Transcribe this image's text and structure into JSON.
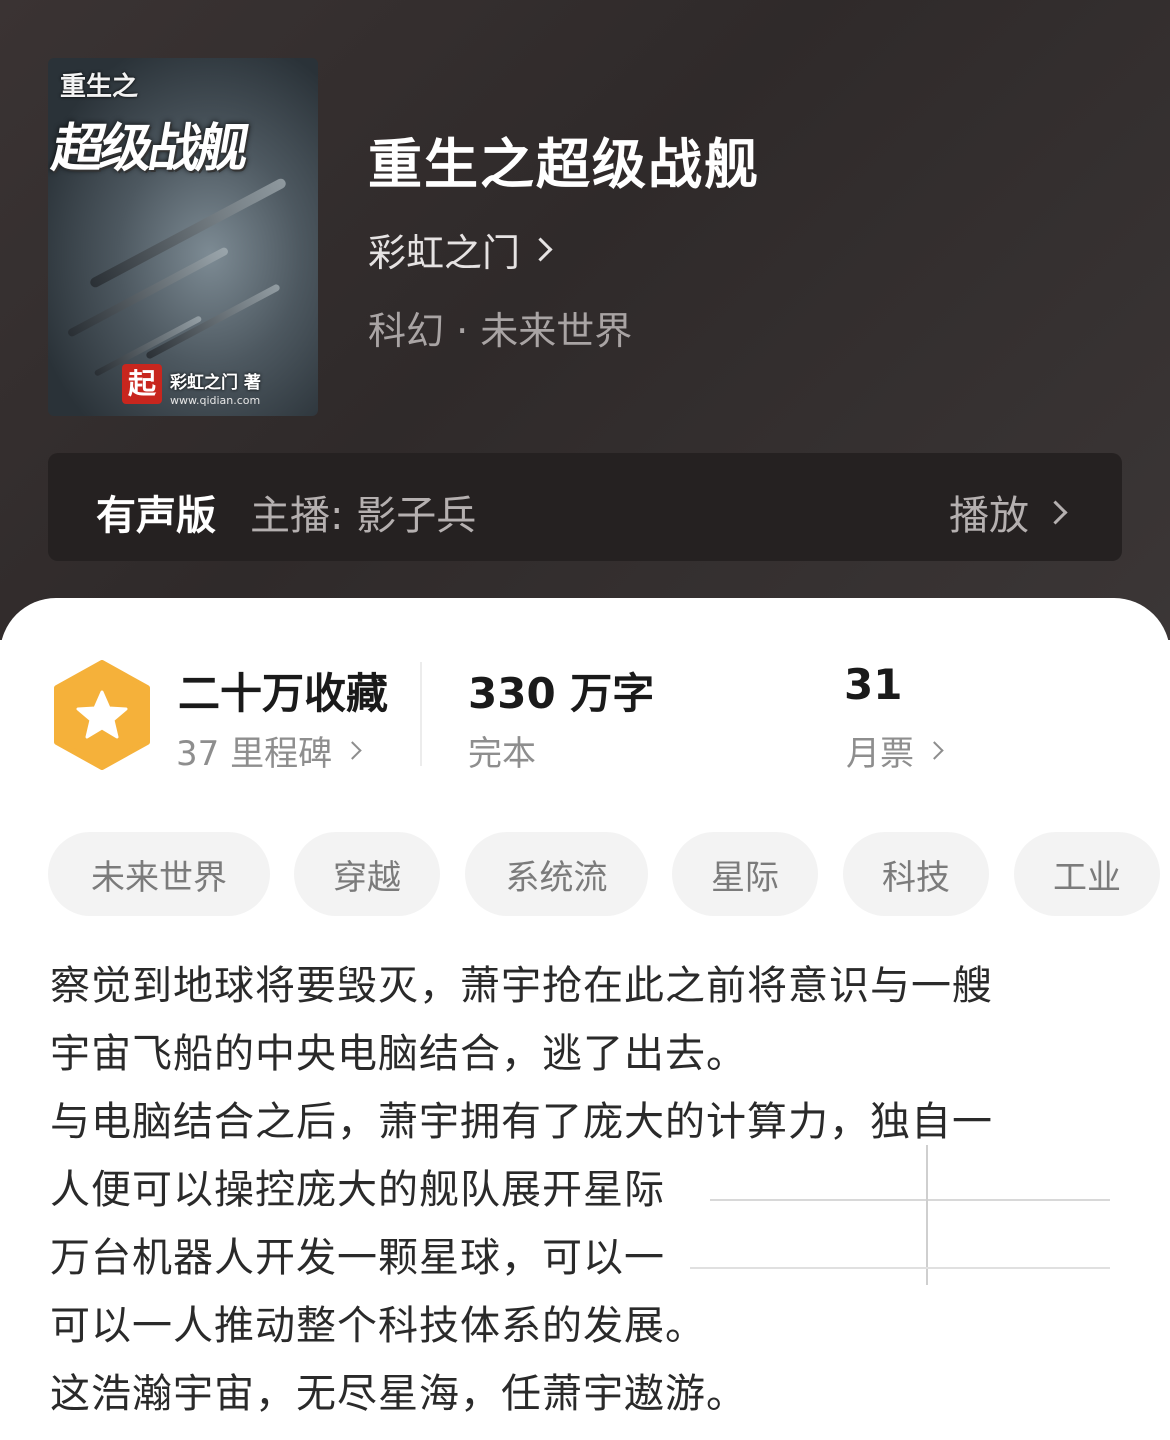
{
  "book": {
    "title": "重生之超级战舰",
    "author": "彩虹之门",
    "genre": "科幻 · 未来世界"
  },
  "cover": {
    "small_title": "重生之",
    "big_title": "超级战舰",
    "logo_char": "起",
    "author_text": "彩虹之门 著",
    "url_text": "www.qidian.com"
  },
  "audio": {
    "label": "有声版",
    "host": "主播: 影子兵",
    "play": "播放"
  },
  "stats": {
    "favorites": "二十万收藏",
    "milestones": "37 里程碑",
    "words": "330 万字",
    "status": "完本",
    "tickets": "31",
    "tickets_label": "月票"
  },
  "tags": [
    "未来世界",
    "穿越",
    "系统流",
    "星际",
    "科技",
    "工业"
  ],
  "description": [
    "察觉到地球将要毁灭，萧宇抢在此之前将意识与一艘",
    "宇宙飞船的中央电脑结合，逃了出去。",
    "与电脑结合之后，萧宇拥有了庞大的计算力，独自一",
    "人便可以操控庞大的舰队展开星际",
    "万台机器人开发一颗星球，可以一",
    "可以一人推动整个科技体系的发展。",
    "这浩瀚宇宙，无尽星海，任萧宇遨游。"
  ],
  "colors": {
    "badge": "#f5b13a",
    "hero_bg": "#332d2d"
  }
}
